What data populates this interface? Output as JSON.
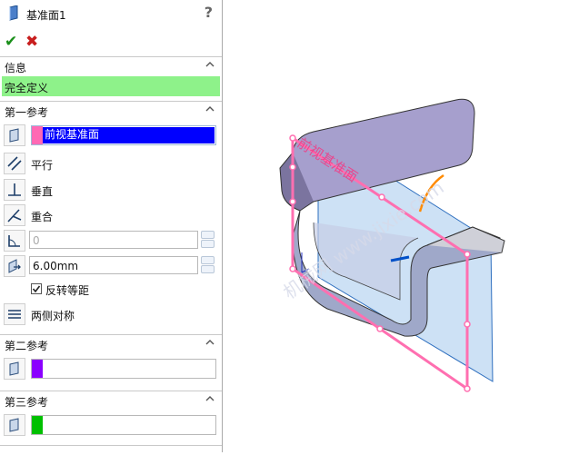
{
  "panel": {
    "title": "基准面1",
    "help_glyph": "?",
    "ok_glyph": "✔",
    "cancel_glyph": "✖"
  },
  "info": {
    "header": "信息",
    "status_text": "完全定义",
    "status_color": "#8ef28a"
  },
  "first_ref": {
    "header": "第一参考",
    "selection": "前视基准面",
    "selection_color": "#ff69b4",
    "options": {
      "parallel": "平行",
      "perpendicular": "垂直",
      "coincident": "重合"
    },
    "angle_value": "0",
    "distance_value": "6.00mm",
    "flip_offset_label": "反转等距",
    "flip_offset_checked": true,
    "symmetric_label": "两侧对称"
  },
  "second_ref": {
    "header": "第二参考",
    "swatch_color": "#8b00ff"
  },
  "third_ref": {
    "header": "第三参考",
    "swatch_color": "#00c000"
  },
  "viewport": {
    "plane_label": "前视基准面",
    "watermark": "机械网 www.jixie.com"
  }
}
